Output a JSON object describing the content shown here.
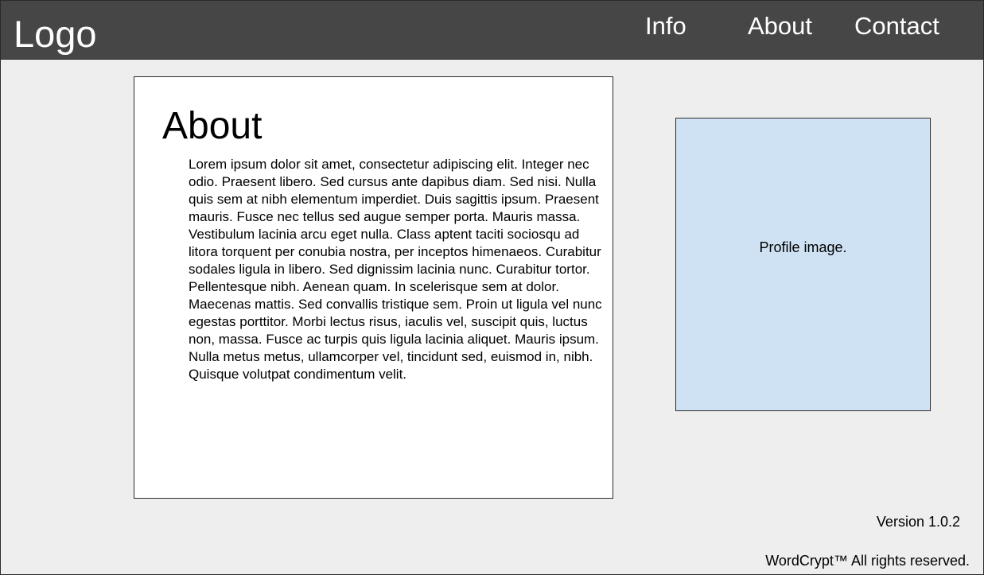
{
  "header": {
    "logo": "Logo",
    "nav": {
      "info": "Info",
      "about": "About",
      "contact": "Contact"
    }
  },
  "about": {
    "title": "About",
    "body": "Lorem ipsum dolor sit amet, consectetur adipiscing elit. Integer nec odio. Praesent libero. Sed cursus ante dapibus diam. Sed nisi. Nulla quis sem at nibh elementum imperdiet. Duis sagittis ipsum. Praesent mauris. Fusce nec tellus sed augue semper porta. Mauris massa. Vestibulum lacinia arcu eget nulla. Class aptent taciti sociosqu ad litora torquent per conubia nostra, per inceptos himenaeos. Curabitur sodales ligula in libero. Sed dignissim lacinia nunc. Curabitur tortor. Pellentesque nibh. Aenean quam. In scelerisque sem at dolor. Maecenas mattis. Sed convallis tristique sem. Proin ut ligula vel nunc egestas porttitor. Morbi lectus risus, iaculis vel, suscipit quis, luctus non, massa. Fusce ac turpis quis ligula lacinia aliquet. Mauris ipsum. Nulla metus metus, ullamcorper vel, tincidunt sed, euismod in, nibh. Quisque volutpat condimentum velit."
  },
  "profile": {
    "label": "Profile image."
  },
  "footer": {
    "version": "Version 1.0.2",
    "copyright": "WordCrypt™ All rights reserved."
  },
  "colors": {
    "header_bg": "#464646",
    "page_bg": "#eeeeee",
    "card_bg": "#ffffff",
    "profile_bg": "#cfe2f3",
    "border": "#2b2b2b"
  }
}
